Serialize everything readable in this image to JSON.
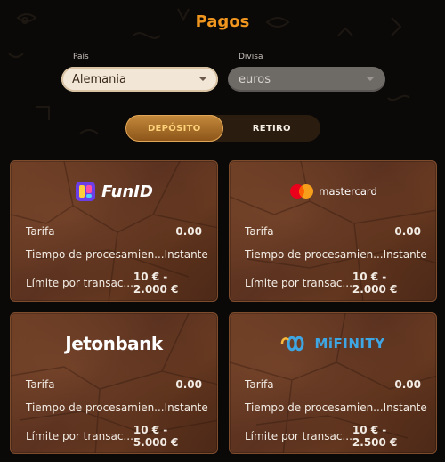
{
  "page": {
    "title": "Pagos"
  },
  "filters": {
    "country_label": "País",
    "country_value": "Alemania",
    "currency_label": "Divisa",
    "currency_value": "euros"
  },
  "tabs": [
    {
      "label": "DEPÓSITO",
      "active": true
    },
    {
      "label": "RETIRO",
      "active": false
    }
  ],
  "methods": [
    {
      "name": "FunID",
      "logo_text": "FunID",
      "rows": [
        {
          "label": "Tarifa",
          "value": "0.00"
        },
        {
          "label": "Tiempo de procesamien...",
          "value": "Instante"
        },
        {
          "label": "Límite por transac...",
          "value": "10 € - 2.000 €"
        }
      ]
    },
    {
      "name": "mastercard",
      "logo_text": "mastercard",
      "rows": [
        {
          "label": "Tarifa",
          "value": "0.00"
        },
        {
          "label": "Tiempo de procesamien...",
          "value": "Instante"
        },
        {
          "label": "Límite por transac...",
          "value": "10 € - 2.000 €"
        }
      ]
    },
    {
      "name": "Jetonbank",
      "logo_text": "Jetonbank",
      "rows": [
        {
          "label": "Tarifa",
          "value": "0.00"
        },
        {
          "label": "Tiempo de procesamien...",
          "value": "Instante"
        },
        {
          "label": "Límite por transac...",
          "value": "10 € - 5.000 €"
        }
      ]
    },
    {
      "name": "MiFINITY",
      "logo_text": "MiFINITY",
      "rows": [
        {
          "label": "Tarifa",
          "value": "0.00"
        },
        {
          "label": "Tiempo de procesamien...",
          "value": "Instante"
        },
        {
          "label": "Límite por transac...",
          "value": "10 € - 2.500 €"
        }
      ]
    }
  ],
  "colors": {
    "accent": "#f0961f",
    "background": "#0b0908",
    "card": "#5b3220",
    "mifinity_blue": "#3fa6e4"
  },
  "icons": [
    "chevron-down-icon",
    "funid-logo-icon",
    "mastercard-circles-icon",
    "mifinity-infinity-icon"
  ]
}
